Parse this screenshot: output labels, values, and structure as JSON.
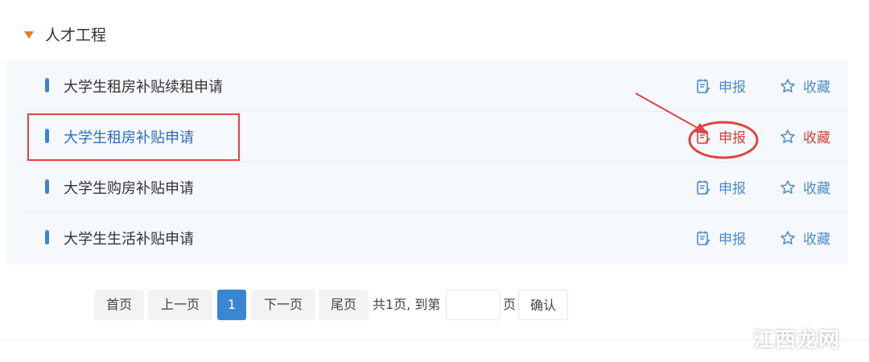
{
  "section": {
    "title": "人才工程"
  },
  "rows": [
    {
      "title": "大学生租房补贴续租申请",
      "apply_label": "申报",
      "fav_label": "收藏"
    },
    {
      "title": "大学生租房补贴申请",
      "apply_label": "申报",
      "fav_label": "收藏"
    },
    {
      "title": "大学生购房补贴申请",
      "apply_label": "申报",
      "fav_label": "收藏"
    },
    {
      "title": "大学生生活补贴申请",
      "apply_label": "申报",
      "fav_label": "收藏"
    }
  ],
  "pagination": {
    "first": "首页",
    "prev": "上一页",
    "current": "1",
    "next": "下一页",
    "last": "尾页",
    "total_text": "共1页, 到第",
    "page_unit": "页",
    "goto_value": "",
    "confirm": "确认"
  },
  "watermark": "江西龙网",
  "colors": {
    "accent": "#3b86d3",
    "link": "#4c8cca",
    "annotation_red": "#e04444",
    "triangle": "#e8792a"
  }
}
